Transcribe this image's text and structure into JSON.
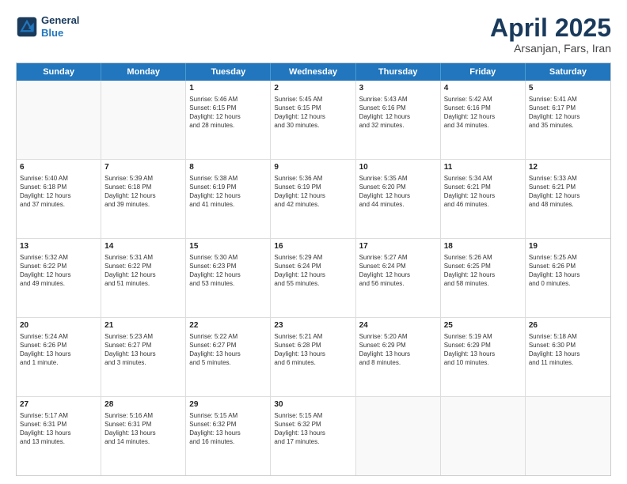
{
  "header": {
    "logo_line1": "General",
    "logo_line2": "Blue",
    "title": "April 2025",
    "subtitle": "Arsanjan, Fars, Iran"
  },
  "days": [
    "Sunday",
    "Monday",
    "Tuesday",
    "Wednesday",
    "Thursday",
    "Friday",
    "Saturday"
  ],
  "rows": [
    [
      {
        "day": "",
        "info": ""
      },
      {
        "day": "",
        "info": ""
      },
      {
        "day": "1",
        "info": "Sunrise: 5:46 AM\nSunset: 6:15 PM\nDaylight: 12 hours\nand 28 minutes."
      },
      {
        "day": "2",
        "info": "Sunrise: 5:45 AM\nSunset: 6:15 PM\nDaylight: 12 hours\nand 30 minutes."
      },
      {
        "day": "3",
        "info": "Sunrise: 5:43 AM\nSunset: 6:16 PM\nDaylight: 12 hours\nand 32 minutes."
      },
      {
        "day": "4",
        "info": "Sunrise: 5:42 AM\nSunset: 6:16 PM\nDaylight: 12 hours\nand 34 minutes."
      },
      {
        "day": "5",
        "info": "Sunrise: 5:41 AM\nSunset: 6:17 PM\nDaylight: 12 hours\nand 35 minutes."
      }
    ],
    [
      {
        "day": "6",
        "info": "Sunrise: 5:40 AM\nSunset: 6:18 PM\nDaylight: 12 hours\nand 37 minutes."
      },
      {
        "day": "7",
        "info": "Sunrise: 5:39 AM\nSunset: 6:18 PM\nDaylight: 12 hours\nand 39 minutes."
      },
      {
        "day": "8",
        "info": "Sunrise: 5:38 AM\nSunset: 6:19 PM\nDaylight: 12 hours\nand 41 minutes."
      },
      {
        "day": "9",
        "info": "Sunrise: 5:36 AM\nSunset: 6:19 PM\nDaylight: 12 hours\nand 42 minutes."
      },
      {
        "day": "10",
        "info": "Sunrise: 5:35 AM\nSunset: 6:20 PM\nDaylight: 12 hours\nand 44 minutes."
      },
      {
        "day": "11",
        "info": "Sunrise: 5:34 AM\nSunset: 6:21 PM\nDaylight: 12 hours\nand 46 minutes."
      },
      {
        "day": "12",
        "info": "Sunrise: 5:33 AM\nSunset: 6:21 PM\nDaylight: 12 hours\nand 48 minutes."
      }
    ],
    [
      {
        "day": "13",
        "info": "Sunrise: 5:32 AM\nSunset: 6:22 PM\nDaylight: 12 hours\nand 49 minutes."
      },
      {
        "day": "14",
        "info": "Sunrise: 5:31 AM\nSunset: 6:22 PM\nDaylight: 12 hours\nand 51 minutes."
      },
      {
        "day": "15",
        "info": "Sunrise: 5:30 AM\nSunset: 6:23 PM\nDaylight: 12 hours\nand 53 minutes."
      },
      {
        "day": "16",
        "info": "Sunrise: 5:29 AM\nSunset: 6:24 PM\nDaylight: 12 hours\nand 55 minutes."
      },
      {
        "day": "17",
        "info": "Sunrise: 5:27 AM\nSunset: 6:24 PM\nDaylight: 12 hours\nand 56 minutes."
      },
      {
        "day": "18",
        "info": "Sunrise: 5:26 AM\nSunset: 6:25 PM\nDaylight: 12 hours\nand 58 minutes."
      },
      {
        "day": "19",
        "info": "Sunrise: 5:25 AM\nSunset: 6:26 PM\nDaylight: 13 hours\nand 0 minutes."
      }
    ],
    [
      {
        "day": "20",
        "info": "Sunrise: 5:24 AM\nSunset: 6:26 PM\nDaylight: 13 hours\nand 1 minute."
      },
      {
        "day": "21",
        "info": "Sunrise: 5:23 AM\nSunset: 6:27 PM\nDaylight: 13 hours\nand 3 minutes."
      },
      {
        "day": "22",
        "info": "Sunrise: 5:22 AM\nSunset: 6:27 PM\nDaylight: 13 hours\nand 5 minutes."
      },
      {
        "day": "23",
        "info": "Sunrise: 5:21 AM\nSunset: 6:28 PM\nDaylight: 13 hours\nand 6 minutes."
      },
      {
        "day": "24",
        "info": "Sunrise: 5:20 AM\nSunset: 6:29 PM\nDaylight: 13 hours\nand 8 minutes."
      },
      {
        "day": "25",
        "info": "Sunrise: 5:19 AM\nSunset: 6:29 PM\nDaylight: 13 hours\nand 10 minutes."
      },
      {
        "day": "26",
        "info": "Sunrise: 5:18 AM\nSunset: 6:30 PM\nDaylight: 13 hours\nand 11 minutes."
      }
    ],
    [
      {
        "day": "27",
        "info": "Sunrise: 5:17 AM\nSunset: 6:31 PM\nDaylight: 13 hours\nand 13 minutes."
      },
      {
        "day": "28",
        "info": "Sunrise: 5:16 AM\nSunset: 6:31 PM\nDaylight: 13 hours\nand 14 minutes."
      },
      {
        "day": "29",
        "info": "Sunrise: 5:15 AM\nSunset: 6:32 PM\nDaylight: 13 hours\nand 16 minutes."
      },
      {
        "day": "30",
        "info": "Sunrise: 5:15 AM\nSunset: 6:32 PM\nDaylight: 13 hours\nand 17 minutes."
      },
      {
        "day": "",
        "info": ""
      },
      {
        "day": "",
        "info": ""
      },
      {
        "day": "",
        "info": ""
      }
    ]
  ]
}
